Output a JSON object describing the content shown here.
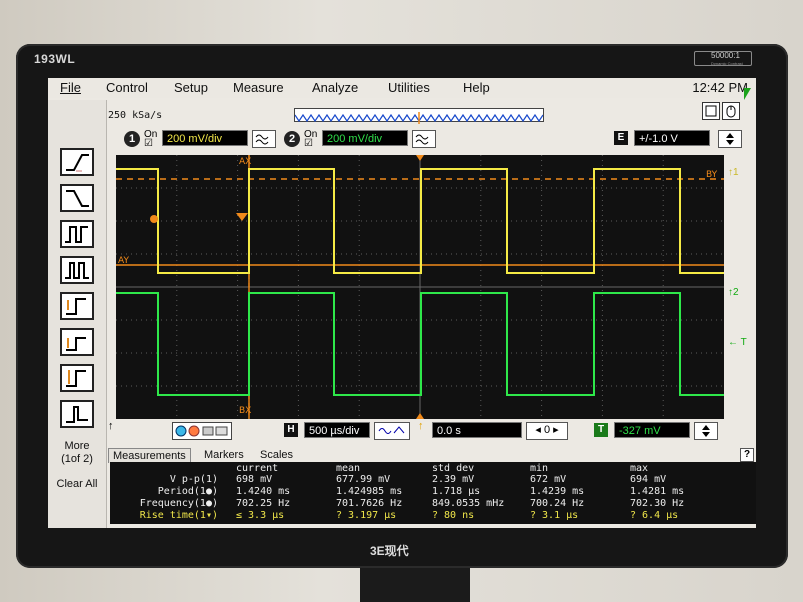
{
  "monitor": {
    "brand": "193WL",
    "contrast_badge": "50000:1",
    "contrast_sub": "Dynamic Contrast",
    "logo": "3E现代"
  },
  "menu": {
    "items": [
      "File",
      "Control",
      "Setup",
      "Measure",
      "Analyze",
      "Utilities",
      "Help"
    ],
    "clock": "12:42 PM"
  },
  "acquisition": {
    "sample_rate": "250 kSa/s"
  },
  "channels": [
    {
      "num": "1",
      "on": "On",
      "scale": "200 mV/div",
      "color": "#f3e94a"
    },
    {
      "num": "2",
      "on": "On",
      "scale": "200 mV/div",
      "color": "#2fe04a"
    }
  ],
  "offset": {
    "key": "E",
    "value": "+/-1.0 V"
  },
  "left_toolbar": {
    "more_label": "More (1of 2)",
    "clear_label": "Clear All"
  },
  "waveform": {
    "marker_labels": {
      "ax": "AX",
      "bx": "BX",
      "ay": "AY",
      "by": "BY"
    },
    "right_markers": [
      "↑1",
      "↑2",
      "← T"
    ],
    "colors": {
      "ch1": "#f5ea45",
      "ch2": "#2ee84a",
      "marker": "#f18a1a",
      "grid": "#5a5a5a",
      "bg": "#111111"
    }
  },
  "timebase": {
    "h_key": "H",
    "scale": "500 µs/div",
    "delay": "0.0 s",
    "nav_center": "0",
    "trigger_key": "T",
    "trigger_level": "-327 mV"
  },
  "tabs": [
    "Measurements",
    "Markers",
    "Scales"
  ],
  "measurements": {
    "headers": [
      "current",
      "mean",
      "std dev",
      "min",
      "max"
    ],
    "rows": [
      {
        "name": "V p-p(1)",
        "current": "698 mV",
        "mean": "677.99 mV",
        "std": "2.39 mV",
        "min": "672 mV",
        "max": "694 mV"
      },
      {
        "name": "Period(1●)",
        "current": "1.4240 ms",
        "mean": "1.424985 ms",
        "std": "1.718 µs",
        "min": "1.4239 ms",
        "max": "1.4281 ms"
      },
      {
        "name": "Frequency(1●)",
        "current": "702.25 Hz",
        "mean": "701.7626 Hz",
        "std": "849.0535 mHz",
        "min": "700.24 Hz",
        "max": "702.30 Hz"
      },
      {
        "name": "Rise time(1▾)",
        "current": "≤ 3.3 µs",
        "mean": "? 3.197 µs",
        "std": "? 80 ns",
        "min": "? 3.1 µs",
        "max": "? 6.4 µs"
      }
    ]
  }
}
